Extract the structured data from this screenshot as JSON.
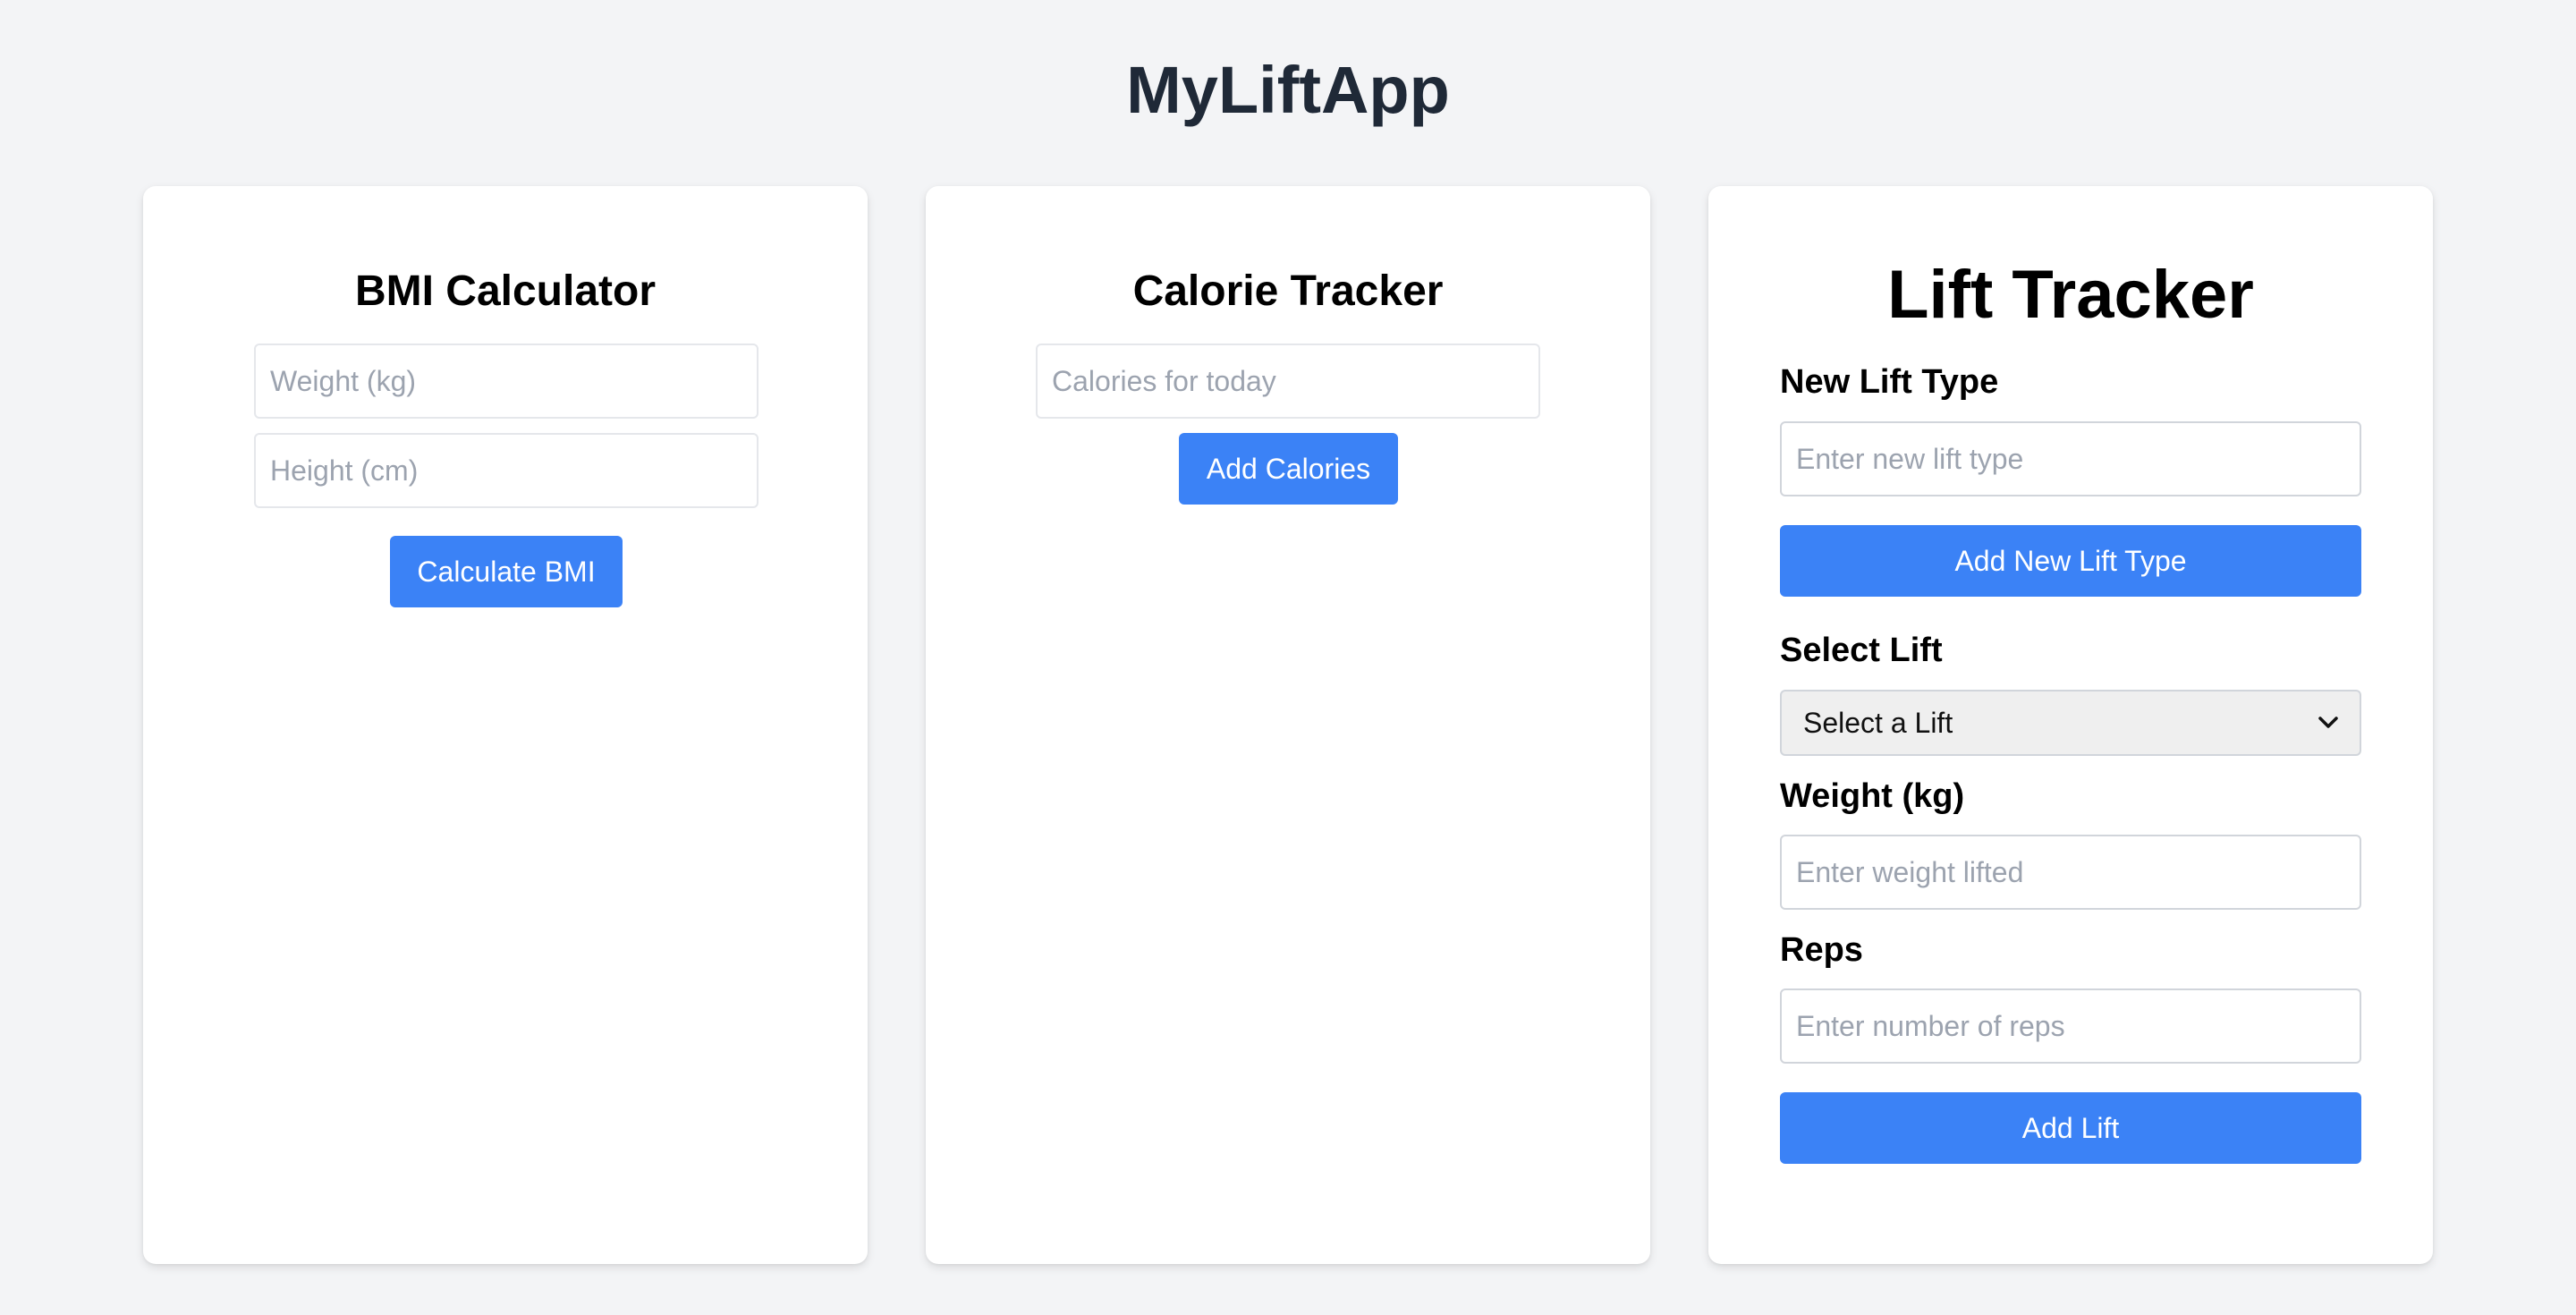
{
  "app": {
    "title": "MyLiftApp"
  },
  "bmi": {
    "title": "BMI Calculator",
    "weight_placeholder": "Weight (kg)",
    "height_placeholder": "Height (cm)",
    "button_label": "Calculate BMI"
  },
  "calories": {
    "title": "Calorie Tracker",
    "input_placeholder": "Calories for today",
    "button_label": "Add Calories"
  },
  "lift": {
    "title": "Lift Tracker",
    "new_type_label": "New Lift Type",
    "new_type_placeholder": "Enter new lift type",
    "add_type_button": "Add New Lift Type",
    "select_label": "Select Lift",
    "select_value": "Select a Lift",
    "weight_label": "Weight (kg)",
    "weight_placeholder": "Enter weight lifted",
    "reps_label": "Reps",
    "reps_placeholder": "Enter number of reps",
    "add_lift_button": "Add Lift"
  },
  "colors": {
    "background": "#f3f4f6",
    "primary_button": "#3b82f6",
    "title_text": "#1f2937",
    "placeholder": "#9ca3af"
  },
  "icons": {
    "select_caret": "chevron-down-icon"
  }
}
